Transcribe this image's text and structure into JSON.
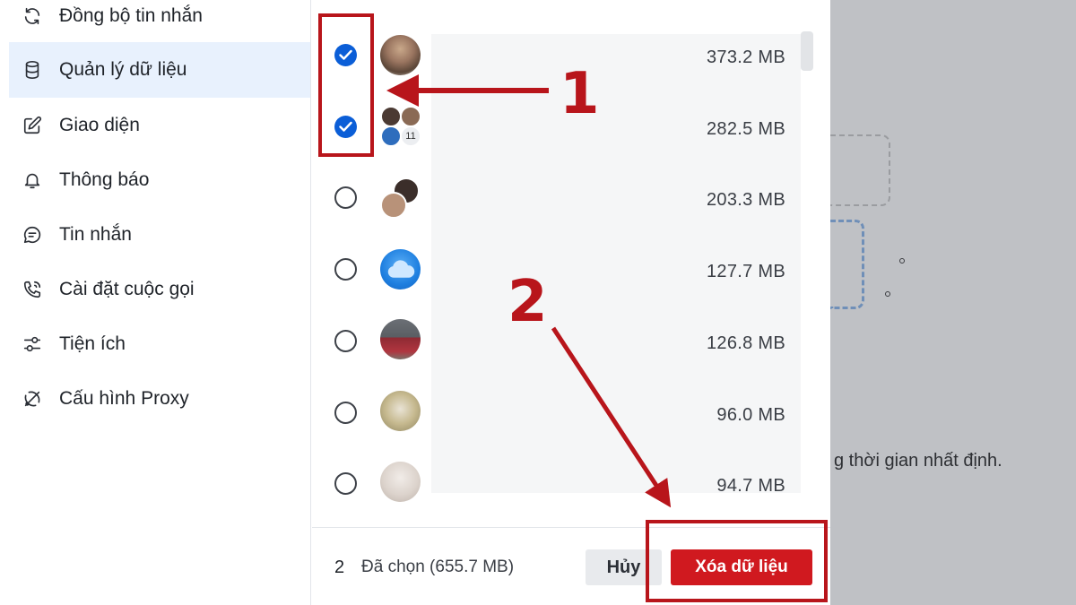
{
  "sidebar": {
    "items": [
      {
        "label": "Đồng bộ tin nhắn",
        "icon": "sync-icon"
      },
      {
        "label": "Quản lý dữ liệu",
        "icon": "database-icon"
      },
      {
        "label": "Giao diện",
        "icon": "edit-icon"
      },
      {
        "label": "Thông báo",
        "icon": "bell-icon"
      },
      {
        "label": "Tin nhắn",
        "icon": "chat-icon"
      },
      {
        "label": "Cài đặt cuộc gọi",
        "icon": "phone-icon"
      },
      {
        "label": "Tiện ích",
        "icon": "sliders-icon"
      },
      {
        "label": "Cấu hình Proxy",
        "icon": "proxy-icon"
      }
    ],
    "active_index": 1
  },
  "list": {
    "rows": [
      {
        "size": "373.2 MB",
        "checked": true
      },
      {
        "size": "282.5 MB",
        "checked": true,
        "group_badge": "11"
      },
      {
        "size": "203.3 MB",
        "checked": false
      },
      {
        "size": "127.7 MB",
        "checked": false
      },
      {
        "size": "126.8 MB",
        "checked": false
      },
      {
        "size": "96.0 MB",
        "checked": false
      },
      {
        "size": "94.7 MB",
        "checked": false
      }
    ]
  },
  "footer": {
    "count": "2",
    "selected_label": "Đã chọn (655.7 MB)",
    "cancel_label": "Hủy",
    "delete_label": "Xóa dữ liệu"
  },
  "background": {
    "partial_text": "g thời gian nhất định."
  },
  "annotations": {
    "step1": "1",
    "step2": "2",
    "color": "#b8151b"
  },
  "colors": {
    "accent": "#0b5ed7",
    "danger": "#d0191f",
    "active_bg": "#e8f1fd"
  }
}
